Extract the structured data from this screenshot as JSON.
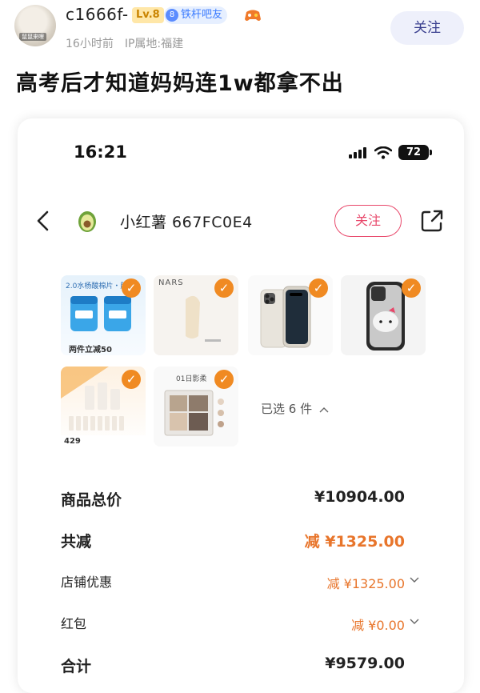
{
  "post": {
    "avatar_tag": "鼠鼠来哩",
    "username": "c1666f-",
    "level": "Lv.8",
    "member_level": "8",
    "member_title": "铁杆吧友",
    "time": "16小时前",
    "ip": "IP属地:福建",
    "follow_label": "关注",
    "title": "高考后才知道妈妈连1w都拿不出"
  },
  "screenshot": {
    "time": "16:21",
    "battery": "72",
    "shop_name": "小红薯 667FC0E4",
    "follow_label": "关注",
    "products": [
      {
        "name": "精华棉片套装",
        "tag_top": "2.0水杨酸棉片・肤质",
        "tag_bottom": "两件立减50"
      },
      {
        "name": "粉底液",
        "tag_top": "NARS",
        "tag_bottom": ""
      },
      {
        "name": "手机 白色钛金属",
        "tag_top": "",
        "tag_bottom": ""
      },
      {
        "name": "手机壳 凯蒂猫",
        "tag_top": "",
        "tag_bottom": ""
      },
      {
        "name": "护肤组合",
        "tag_top": "",
        "tag_bottom": "429"
      },
      {
        "name": "眼影盘",
        "tag_top": "01日影柔",
        "tag_bottom": ""
      }
    ],
    "selected_text": "已选 6 件",
    "rows": [
      {
        "label": "商品总价",
        "value": "¥10904.00"
      },
      {
        "label": "共减",
        "value": "减 ¥1325.00"
      },
      {
        "label": "店铺优惠",
        "value": "减 ¥1325.00"
      },
      {
        "label": "红包",
        "value": "减 ¥0.00"
      },
      {
        "label": "合计",
        "value": "¥9579.00"
      }
    ]
  },
  "colors": {
    "accent_orange": "#e8752b",
    "follow_pink": "#e8476a",
    "check_orange": "#f08a22"
  }
}
